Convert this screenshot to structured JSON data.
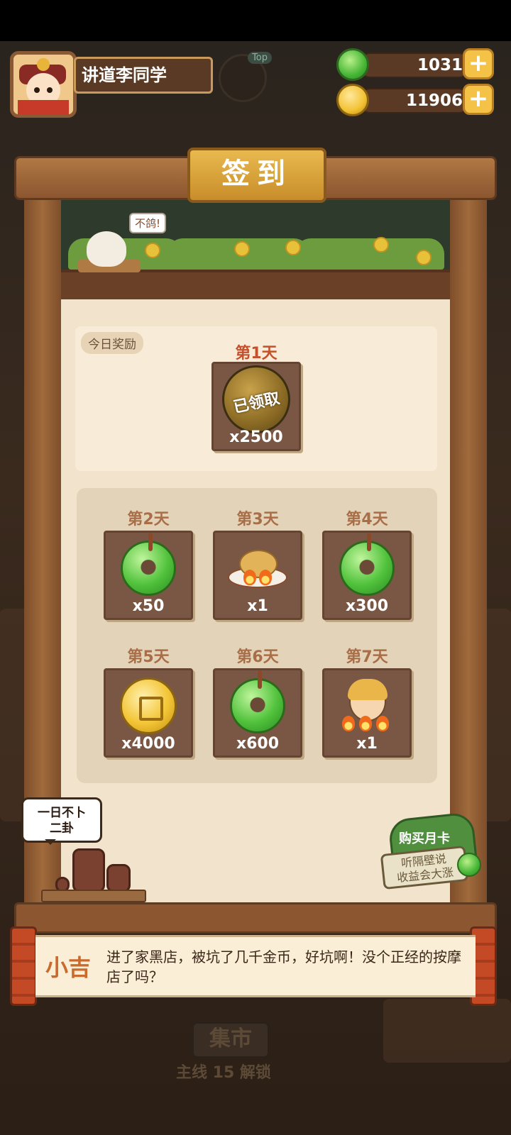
{
  "player": {
    "name": "讲道李同学"
  },
  "top_button": {
    "label": "Top"
  },
  "resources": [
    {
      "name": "jade",
      "value": "1031"
    },
    {
      "name": "coins",
      "value": "11906"
    }
  ],
  "signin": {
    "title": "签到",
    "bird_bubble": "不鸽!",
    "today_tag": "今日奖励",
    "today": {
      "day": "第1天",
      "status": "已领取",
      "qty": "x2500"
    },
    "days": [
      {
        "day": "第2天",
        "item": "jade-icon",
        "qty": "x50"
      },
      {
        "day": "第3天",
        "item": "dish-icon",
        "qty": "x1"
      },
      {
        "day": "第4天",
        "item": "jade-icon",
        "qty": "x300"
      },
      {
        "day": "第5天",
        "item": "coin-icon",
        "qty": "x4000"
      },
      {
        "day": "第6天",
        "item": "jade-icon",
        "qty": "x600"
      },
      {
        "day": "第7天",
        "item": "character-icon",
        "qty": "x1"
      }
    ]
  },
  "thought_bubble": "一日不卜\n二卦",
  "monthly_card": {
    "title": "购买月卡",
    "subtitle": "听隔壁说\n收益会大涨"
  },
  "dialog": {
    "speaker": "小吉",
    "text": "进了家黑店，被坑了几千金币，好坑啊！没个正经的按摩店了吗？"
  },
  "market": {
    "label": "集市",
    "unlock_text": "主线 15 解锁"
  },
  "colors": {
    "accent": "#e2b245",
    "wood": "#8c5630",
    "paper": "#f2e4cc",
    "highlight": "#c4502c"
  }
}
